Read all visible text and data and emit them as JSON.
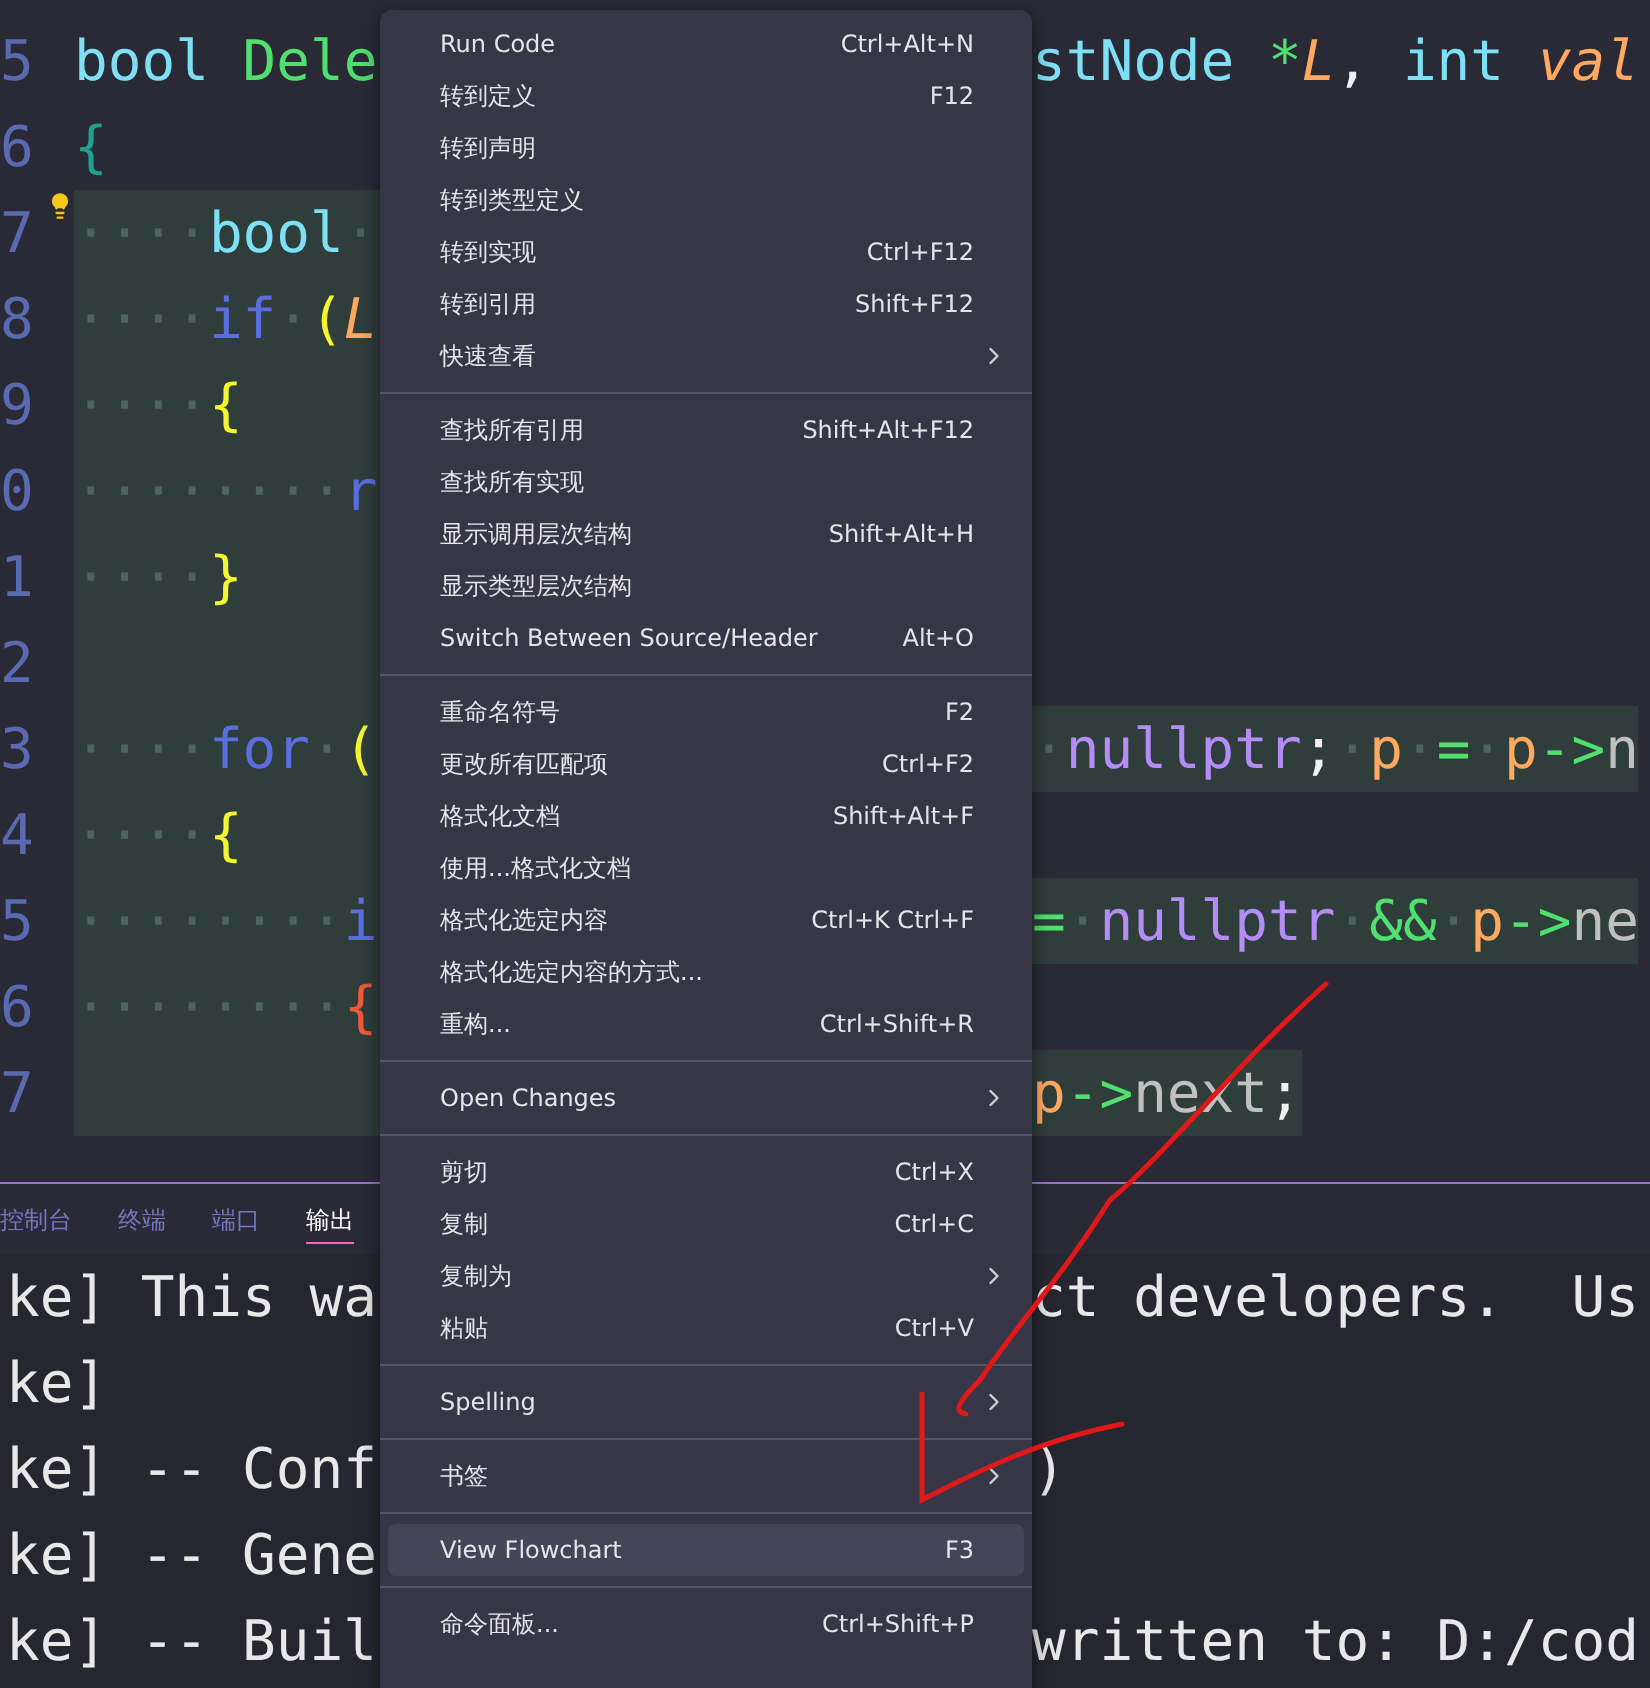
{
  "editor": {
    "lines": [
      {
        "number": "5",
        "highlighted": false,
        "bulb": false,
        "left": [
          {
            "text": "bool ",
            "kind": "type"
          },
          {
            "text": "Dele",
            "kind": "func"
          }
        ],
        "right": [
          {
            "text": "stNode ",
            "kind": "type"
          },
          {
            "text": "*",
            "kind": "op"
          },
          {
            "text": "L",
            "kind": "param"
          },
          {
            "text": ", ",
            "kind": "punct"
          },
          {
            "text": "int ",
            "kind": "type"
          },
          {
            "text": "val",
            "kind": "param"
          }
        ]
      },
      {
        "number": "6",
        "highlighted": false,
        "bulb": false,
        "left": [
          {
            "text": "{",
            "kind": "brace0"
          }
        ]
      },
      {
        "number": "7",
        "highlighted": true,
        "bulb": true,
        "left": [
          {
            "text": "····",
            "kind": "ws"
          },
          {
            "text": "bool",
            "kind": "type"
          },
          {
            "text": "·",
            "kind": "ws"
          }
        ]
      },
      {
        "number": "8",
        "highlighted": true,
        "bulb": false,
        "left": [
          {
            "text": "····",
            "kind": "ws"
          },
          {
            "text": "if",
            "kind": "keyword"
          },
          {
            "text": "·",
            "kind": "ws"
          },
          {
            "text": "(",
            "kind": "brace1"
          },
          {
            "text": "L",
            "kind": "param"
          }
        ]
      },
      {
        "number": "9",
        "highlighted": true,
        "bulb": false,
        "left": [
          {
            "text": "····",
            "kind": "ws"
          },
          {
            "text": "{",
            "kind": "brace1"
          }
        ]
      },
      {
        "number": "0",
        "highlighted": true,
        "bulb": false,
        "left": [
          {
            "text": "········",
            "kind": "ws"
          },
          {
            "text": "r",
            "kind": "keyword"
          }
        ]
      },
      {
        "number": "1",
        "highlighted": true,
        "bulb": false,
        "left": [
          {
            "text": "····",
            "kind": "ws"
          },
          {
            "text": "}",
            "kind": "brace1"
          }
        ]
      },
      {
        "number": "2",
        "highlighted": true,
        "bulb": false
      },
      {
        "number": "3",
        "highlighted": true,
        "bulb": false,
        "left": [
          {
            "text": "····",
            "kind": "ws"
          },
          {
            "text": "for",
            "kind": "keyword"
          },
          {
            "text": "·",
            "kind": "ws"
          },
          {
            "text": "(",
            "kind": "brace1"
          }
        ],
        "right": [
          {
            "text": "·",
            "kind": "ws"
          },
          {
            "text": "nullptr",
            "kind": "const"
          },
          {
            "text": ";",
            "kind": "punct"
          },
          {
            "text": "·",
            "kind": "ws"
          },
          {
            "text": "p",
            "kind": "var"
          },
          {
            "text": "·",
            "kind": "ws"
          },
          {
            "text": "=",
            "kind": "op"
          },
          {
            "text": "·",
            "kind": "ws"
          },
          {
            "text": "p",
            "kind": "var"
          },
          {
            "text": "->",
            "kind": "op"
          },
          {
            "text": "n",
            "kind": "member"
          }
        ]
      },
      {
        "number": "4",
        "highlighted": true,
        "bulb": false,
        "left": [
          {
            "text": "····",
            "kind": "ws"
          },
          {
            "text": "{",
            "kind": "brace1"
          }
        ]
      },
      {
        "number": "5",
        "highlighted": true,
        "bulb": false,
        "left": [
          {
            "text": "········",
            "kind": "ws"
          },
          {
            "text": "i",
            "kind": "keyword"
          }
        ],
        "right": [
          {
            "text": "=",
            "kind": "op"
          },
          {
            "text": "·",
            "kind": "ws"
          },
          {
            "text": "nullptr",
            "kind": "const"
          },
          {
            "text": "·",
            "kind": "ws"
          },
          {
            "text": "&&",
            "kind": "op"
          },
          {
            "text": "·",
            "kind": "ws"
          },
          {
            "text": "p",
            "kind": "var"
          },
          {
            "text": "->",
            "kind": "op"
          },
          {
            "text": "ne",
            "kind": "member"
          }
        ]
      },
      {
        "number": "6",
        "highlighted": true,
        "bulb": false,
        "left": [
          {
            "text": "········",
            "kind": "ws"
          },
          {
            "text": "{",
            "kind": "brace2"
          }
        ]
      },
      {
        "number": "7",
        "highlighted": true,
        "bulb": false,
        "right": [
          {
            "text": "p",
            "kind": "var"
          },
          {
            "text": "->",
            "kind": "op"
          },
          {
            "text": "next",
            "kind": "member"
          },
          {
            "text": ";",
            "kind": "punct"
          }
        ]
      }
    ]
  },
  "panel": {
    "tabs": [
      {
        "label": "控制台",
        "selected": false
      },
      {
        "label": "终端",
        "selected": false
      },
      {
        "label": "端口",
        "selected": false
      },
      {
        "label": "输出",
        "selected": true
      }
    ],
    "output": [
      {
        "left": "ke] This wa",
        "right": "ct developers.  Us"
      },
      {
        "left": "ke]"
      },
      {
        "left": "ke] -- Conf",
        "right": ")"
      },
      {
        "left": "ke] -- Gene"
      },
      {
        "left": "ke] -- Buil",
        "right": "written to: D:/cod"
      }
    ]
  },
  "context_menu": {
    "groups": [
      [
        {
          "label": "Run Code",
          "shortcut": "Ctrl+Alt+N",
          "submenu": false,
          "selected": false
        },
        {
          "label": "转到定义",
          "shortcut": "F12",
          "submenu": false,
          "selected": false
        },
        {
          "label": "转到声明",
          "submenu": false,
          "selected": false
        },
        {
          "label": "转到类型定义",
          "submenu": false,
          "selected": false
        },
        {
          "label": "转到实现",
          "shortcut": "Ctrl+F12",
          "submenu": false,
          "selected": false
        },
        {
          "label": "转到引用",
          "shortcut": "Shift+F12",
          "submenu": false,
          "selected": false
        },
        {
          "label": "快速查看",
          "submenu": true,
          "selected": false
        }
      ],
      [
        {
          "label": "查找所有引用",
          "shortcut": "Shift+Alt+F12",
          "submenu": false,
          "selected": false
        },
        {
          "label": "查找所有实现",
          "submenu": false,
          "selected": false
        },
        {
          "label": "显示调用层次结构",
          "shortcut": "Shift+Alt+H",
          "submenu": false,
          "selected": false
        },
        {
          "label": "显示类型层次结构",
          "submenu": false,
          "selected": false
        },
        {
          "label": "Switch Between Source/Header",
          "shortcut": "Alt+O",
          "submenu": false,
          "selected": false
        }
      ],
      [
        {
          "label": "重命名符号",
          "shortcut": "F2",
          "submenu": false,
          "selected": false
        },
        {
          "label": "更改所有匹配项",
          "shortcut": "Ctrl+F2",
          "submenu": false,
          "selected": false
        },
        {
          "label": "格式化文档",
          "shortcut": "Shift+Alt+F",
          "submenu": false,
          "selected": false
        },
        {
          "label": "使用...格式化文档",
          "submenu": false,
          "selected": false
        },
        {
          "label": "格式化选定内容",
          "shortcut": "Ctrl+K Ctrl+F",
          "submenu": false,
          "selected": false
        },
        {
          "label": "格式化选定内容的方式...",
          "submenu": false,
          "selected": false
        },
        {
          "label": "重构...",
          "shortcut": "Ctrl+Shift+R",
          "submenu": false,
          "selected": false
        }
      ],
      [
        {
          "label": "Open Changes",
          "submenu": true,
          "selected": false
        }
      ],
      [
        {
          "label": "剪切",
          "shortcut": "Ctrl+X",
          "submenu": false,
          "selected": false
        },
        {
          "label": "复制",
          "shortcut": "Ctrl+C",
          "submenu": false,
          "selected": false
        },
        {
          "label": "复制为",
          "submenu": true,
          "selected": false
        },
        {
          "label": "粘贴",
          "shortcut": "Ctrl+V",
          "submenu": false,
          "selected": false
        }
      ],
      [
        {
          "label": "Spelling",
          "submenu": true,
          "selected": false
        }
      ],
      [
        {
          "label": "书签",
          "submenu": true,
          "selected": false
        }
      ],
      [
        {
          "label": "View Flowchart",
          "shortcut": "F3",
          "submenu": false,
          "selected": true
        }
      ],
      [
        {
          "label": "命令面板...",
          "shortcut": "Ctrl+Shift+P",
          "submenu": false,
          "selected": false
        }
      ]
    ]
  }
}
